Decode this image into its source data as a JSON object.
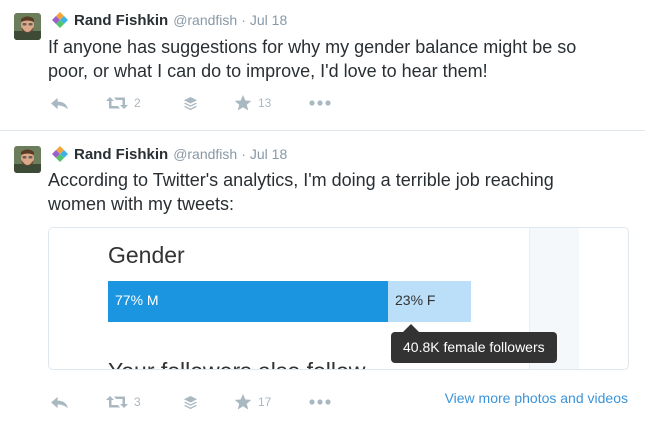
{
  "tweets": [
    {
      "author": {
        "fullname": "Rand Fishkin",
        "username": "@randfish"
      },
      "separator": "·",
      "time": "Jul 18",
      "lines": [
        "If anyone has suggestions for why my gender balance might be so",
        "poor, or what I can do to improve, I'd love to hear them!"
      ],
      "actions": {
        "retweets": "2",
        "favorites": "13"
      }
    },
    {
      "author": {
        "fullname": "Rand Fishkin",
        "username": "@randfish"
      },
      "separator": "·",
      "time": "Jul 18",
      "lines": [
        "According to Twitter's analytics, I'm doing a terrible job reaching",
        "women with my tweets:"
      ],
      "actions": {
        "retweets": "3",
        "favorites": "17"
      },
      "view_more_link": "View more photos and videos"
    }
  ],
  "media": {
    "title": "Gender",
    "male_label": "77% M",
    "female_label": "23% F",
    "tooltip": "40.8K female followers",
    "cut_off_text": "Your followers also follow"
  },
  "chart_data": {
    "type": "bar",
    "title": "Gender",
    "categories": [
      "M",
      "F"
    ],
    "values": [
      77,
      23
    ],
    "unit": "%",
    "stacked": true,
    "orientation": "horizontal"
  },
  "icons": {
    "reply": "reply-icon",
    "retweet": "retweet-icon",
    "stack": "layers-icon",
    "favorite": "star-icon",
    "more": "more-dots-icon",
    "brand": "product-logo-icon"
  },
  "colors": {
    "link": "#3b94d9",
    "action_gray": "#aab8c2",
    "bar_male": "#1b95e0",
    "bar_female": "#bbdff8",
    "tooltip_bg": "#333333"
  }
}
